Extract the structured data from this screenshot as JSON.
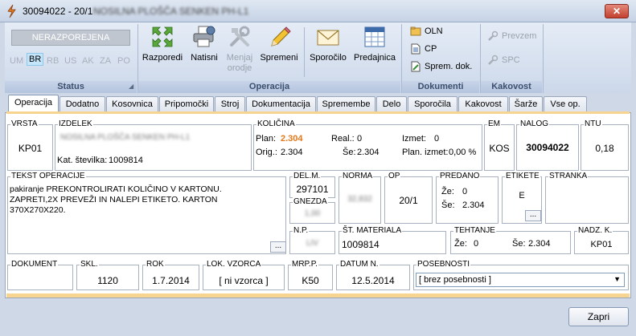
{
  "window": {
    "title": "30094022 - 20/1",
    "title_blurred": "NOSILNA PLOŠČA SENKEN PH-L1",
    "close_label": "✕"
  },
  "ribbon": {
    "status": {
      "box_label": "NERAZPOREJENA",
      "codes": [
        "UM",
        "BR",
        "RB",
        "US",
        "AK",
        "ZA",
        "PO"
      ],
      "active_code": "BR",
      "group_label": "Status"
    },
    "operacija": {
      "group_label": "Operacija",
      "buttons": [
        {
          "label": "Razporedi",
          "icon": "arrows-icon",
          "enabled": true
        },
        {
          "label": "Natisni",
          "icon": "printer-icon",
          "enabled": true
        },
        {
          "label": "Menjaj\norodje",
          "icon": "tools-icon",
          "enabled": false
        },
        {
          "label": "Spremeni",
          "icon": "pencil-icon",
          "enabled": true
        },
        {
          "label": "Sporočilo",
          "icon": "envelope-icon",
          "enabled": true
        },
        {
          "label": "Predajnica",
          "icon": "calendar-grid-icon",
          "enabled": true
        }
      ]
    },
    "dokumenti": {
      "group_label": "Dokumenti",
      "items": [
        {
          "label": "OLN",
          "icon": "folder-icon"
        },
        {
          "label": "CP",
          "icon": "document-icon"
        },
        {
          "label": "Sprem. dok.",
          "icon": "document-edit-icon"
        }
      ]
    },
    "kakovost": {
      "group_label": "Kakovost",
      "items": [
        {
          "label": "Prevzem",
          "icon": "wrench-icon",
          "enabled": false
        },
        {
          "label": "SPC",
          "icon": "wrench-icon",
          "enabled": false
        }
      ]
    }
  },
  "tabs": [
    "Operacija",
    "Dodatno",
    "Kosovnica",
    "Pripomočki",
    "Stroj",
    "Dokumentacija",
    "Spremembe",
    "Delo",
    "Sporočila",
    "Kakovost",
    "Šarže",
    "Vse op."
  ],
  "active_tab": "Operacija",
  "form": {
    "vrsta": {
      "label": "VRSTA",
      "value": "KP01"
    },
    "izdelek": {
      "label": "IZDELEK",
      "name_blurred": "NOSILNA PLOŠČA SENKEN PH-L1",
      "kat_label": "Kat. številka:",
      "kat_value": "1009814"
    },
    "kolicina": {
      "label": "KOLIČINA",
      "plan_label": "Plan:",
      "plan_value": "2.304",
      "orig_label": "Orig.:",
      "orig_value": "2.304",
      "real_label": "Real.:",
      "real_value": "0",
      "se_label": "Še:",
      "se_value": "2.304",
      "izmet_label": "Izmet:",
      "izmet_value": "0",
      "plan_izmet_label": "Plan. izmet:",
      "plan_izmet_value": "0,00 %"
    },
    "em": {
      "label": "EM",
      "value": "KOS"
    },
    "nalog": {
      "label": "NALOG",
      "value": "30094022"
    },
    "ntu": {
      "label": "NTU",
      "value": "0,18"
    },
    "tekst": {
      "label": "TEKST OPERACIJE",
      "value": "pakiranje PREKONTROLIRATI KOLIČINO V KARTONU. ZAPRETI,2X PREVEŽI IN NALEPI ETIKETO. KARTON 370X270X220."
    },
    "delm": {
      "label": "DEL.M.",
      "value": "297101"
    },
    "gnezda": {
      "label": "GNEZDA",
      "value_blurred": "1,00"
    },
    "norma": {
      "label": "NORMA",
      "value_blurred": "32,832"
    },
    "op": {
      "label": "OP",
      "value": "20/1"
    },
    "predano": {
      "label": "PREDANO",
      "ze_label": "Že:",
      "ze_value": "0",
      "se_label": "Še:",
      "se_value": "2.304"
    },
    "etikete": {
      "label": "ETIKETE",
      "value": "E"
    },
    "stranka": {
      "label": "STRANKA",
      "value": ""
    },
    "np": {
      "label": "N.P.",
      "value_blurred": "LIV"
    },
    "st_materiala": {
      "label": "ŠT. MATERIALA",
      "value": "1009814"
    },
    "tehtanje": {
      "label": "TEHTANJE",
      "ze_label": "Že:",
      "ze_value": "0",
      "se_label": "Še:",
      "se_value": "2.304"
    },
    "nadz": {
      "label": "NADZ. K.",
      "value": "KP01"
    },
    "dokument": {
      "label": "DOKUMENT",
      "value": ""
    },
    "skl": {
      "label": "SKL.",
      "value": "1120"
    },
    "rok": {
      "label": "ROK",
      "value": "1.7.2014"
    },
    "lok_vzorca": {
      "label": "LOK. VZORCA",
      "value": "[ ni vzorca ]"
    },
    "mrp": {
      "label": "MRP.P.",
      "value": "K50"
    },
    "datum": {
      "label": "DATUM N.",
      "value": "12.5.2014"
    },
    "posebnosti": {
      "label": "POSEBNOSTI",
      "value": "[ brez posebnosti ]"
    },
    "ellipsis": "..."
  },
  "footer": {
    "close_label": "Zapri"
  },
  "colors": {
    "accent_orange": "#e2791c",
    "ribbon_bg": "#ccd8ea",
    "tab_accent": "#f7d48f"
  }
}
